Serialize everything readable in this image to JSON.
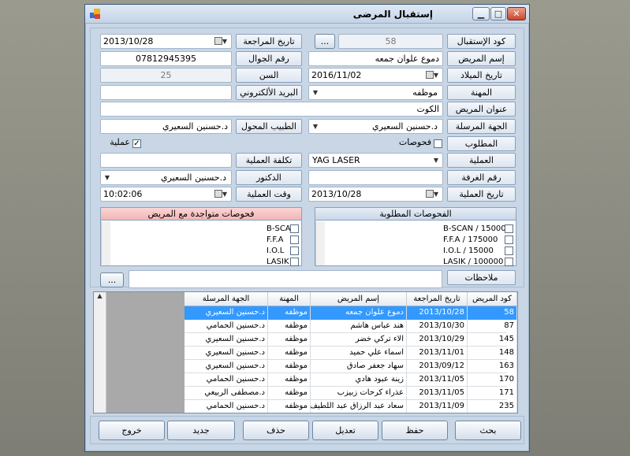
{
  "window": {
    "title": "إستقبال المرضى",
    "min": "▁",
    "max": "□",
    "close": "✕"
  },
  "labels": {
    "reception_code": "كود الإستقبال",
    "patient_name": "إسم المريض",
    "birth_date": "تاريخ الميلاد",
    "profession": "المهنة",
    "patient_address": "عنوان المريض",
    "sending_entity": "الجهة المرسلة",
    "required": "المطلوب",
    "operation": "العملية",
    "room_no": "رقم الغرفة",
    "operation_date": "تاريخ العملية",
    "review_date": "تاريخ المراجعة",
    "mobile": "رقم الجوال",
    "age": "السن",
    "email": "البريد الألكتروني",
    "referring_doctor": "الطبيب المحول",
    "op_cost": "تكلفة العملية",
    "doctor": "الدكتور",
    "op_time": "وقت العملية",
    "notes": "ملاحظات"
  },
  "values": {
    "reception_code": "58",
    "browse": "...",
    "patient_name": "دموع علوان جمعه",
    "birth_date": "2016/11/02",
    "profession": "موظفه",
    "address": "الكوت",
    "sending_entity": "د.حسنين  السعيري",
    "operation": "YAG LASER",
    "operation_date": "2013/10/28",
    "review_date": "2013/10/28",
    "mobile": "07812945395",
    "age": "25",
    "referring_doctor": "د.حسنين السعيري",
    "doctor": "د.حسنين  السعيري",
    "op_time": "10:02:06"
  },
  "checks": {
    "exams_label": "فحوصات",
    "operation_label": "عملية",
    "exams_checked": "",
    "operation_checked": "✓"
  },
  "panels": {
    "required_title": "الفحوصات المطلوبة",
    "required_items": [
      "B-SCAN / 15000",
      "F.F.A / 175000",
      "I.O.L / 15000",
      "LASIK / 100000"
    ],
    "existing_title": "فحوصات متواجدة مع المريض",
    "existing_items": [
      "B-SCAN",
      "F.F.A",
      "I.O.L",
      "LASIK"
    ]
  },
  "notes_button": "...",
  "grid": {
    "headers": [
      "كود المريض",
      "تاريخ المراجعة",
      "إسم المريض",
      "المهنة",
      "الجهة المرسلة"
    ],
    "rows": [
      [
        "58",
        "2013/10/28",
        "دموع علوان جمعه",
        "موظفه",
        "د.حسنين  السعيري"
      ],
      [
        "87",
        "2013/10/30",
        "هند عباس هاشم",
        "موظفه",
        "د.حسنين الحمامي"
      ],
      [
        "145",
        "2013/10/29",
        "الاء تركي خضر",
        "موظفه",
        "د.حسنين  السعيري"
      ],
      [
        "148",
        "2013/11/01",
        "اسماء علي حميد",
        "موظفه",
        "د.حسنين  السعيري"
      ],
      [
        "163",
        "2013/09/12",
        "سهاد جعفر صادق",
        "موظفه",
        "د.حسنين  السعيري"
      ],
      [
        "170",
        "2013/11/05",
        "زينة عبود هادي",
        "موظفه",
        "د.حسنين الحمامي"
      ],
      [
        "171",
        "2013/11/05",
        "عذراء كرحات زبيزب",
        "موظفه",
        "د.مصطفى الربيعي"
      ],
      [
        "235",
        "2013/11/09",
        "سعاد عبد الرزاق عبد اللطيف",
        "موظفه",
        "د.حسنين الحمامي"
      ]
    ]
  },
  "buttons": {
    "search": "بحث",
    "save": "حفظ",
    "edit": "تعديل",
    "delete": "حذف",
    "new": "جديد",
    "exit": "خروج"
  }
}
